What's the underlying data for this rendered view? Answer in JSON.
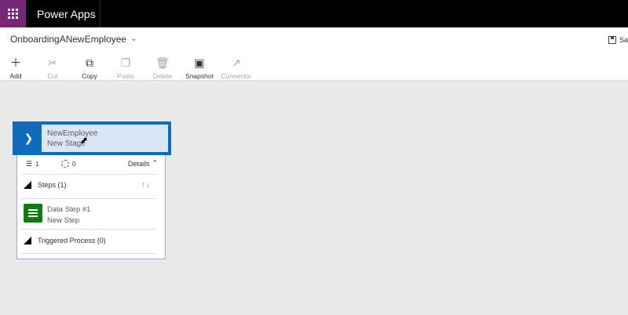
{
  "topbar": {
    "app_title": "Power Apps",
    "waffle_icon": "waffle-icon",
    "accent": "#742774"
  },
  "command": {
    "process_name": "OnboardingANewEmployee",
    "save_label": "Sav",
    "tools": [
      {
        "label": "Add",
        "icon": "plus-icon",
        "enabled": true
      },
      {
        "label": "Cut",
        "icon": "scissors-icon",
        "enabled": false
      },
      {
        "label": "Copy",
        "icon": "copy-icon",
        "enabled": true
      },
      {
        "label": "Paste",
        "icon": "paste-icon",
        "enabled": false
      },
      {
        "label": "Delete",
        "icon": "trash-icon",
        "enabled": false
      },
      {
        "label": "Snapshot",
        "icon": "camera-icon",
        "enabled": true
      },
      {
        "label": "Connector",
        "icon": "connector-icon",
        "enabled": false
      }
    ]
  },
  "stage": {
    "name": "NewEmployee",
    "type": "New Stage",
    "accent": "#0f6cbd",
    "steps_count": "1",
    "loop_count": "0",
    "details_label": "Details",
    "steps_section": "Steps (1)",
    "step": {
      "name": "Data Step #1",
      "sub": "New Step",
      "color": "#107c10"
    },
    "triggered_section": "Triggered Process (0)"
  }
}
